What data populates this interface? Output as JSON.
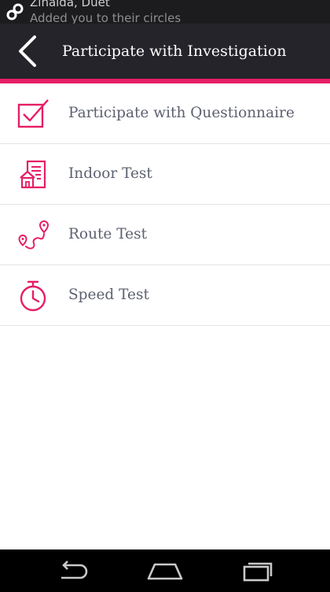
{
  "notification": {
    "line1": "Zinaida, Duet",
    "line2": "Added you to their circles"
  },
  "appbar": {
    "title": "Participate with Investigation"
  },
  "menu": {
    "items": [
      {
        "label": "Participate with Questionnaire",
        "icon": "checkbox-icon"
      },
      {
        "label": "Indoor Test",
        "icon": "building-icon"
      },
      {
        "label": "Route Test",
        "icon": "route-icon"
      },
      {
        "label": "Speed Test",
        "icon": "stopwatch-icon"
      }
    ]
  },
  "colors": {
    "accent": "#e61e66",
    "appbar": "#24242a",
    "statusbar": "#1c1c1e",
    "text": "#5d6170",
    "navbar": "#000000"
  }
}
